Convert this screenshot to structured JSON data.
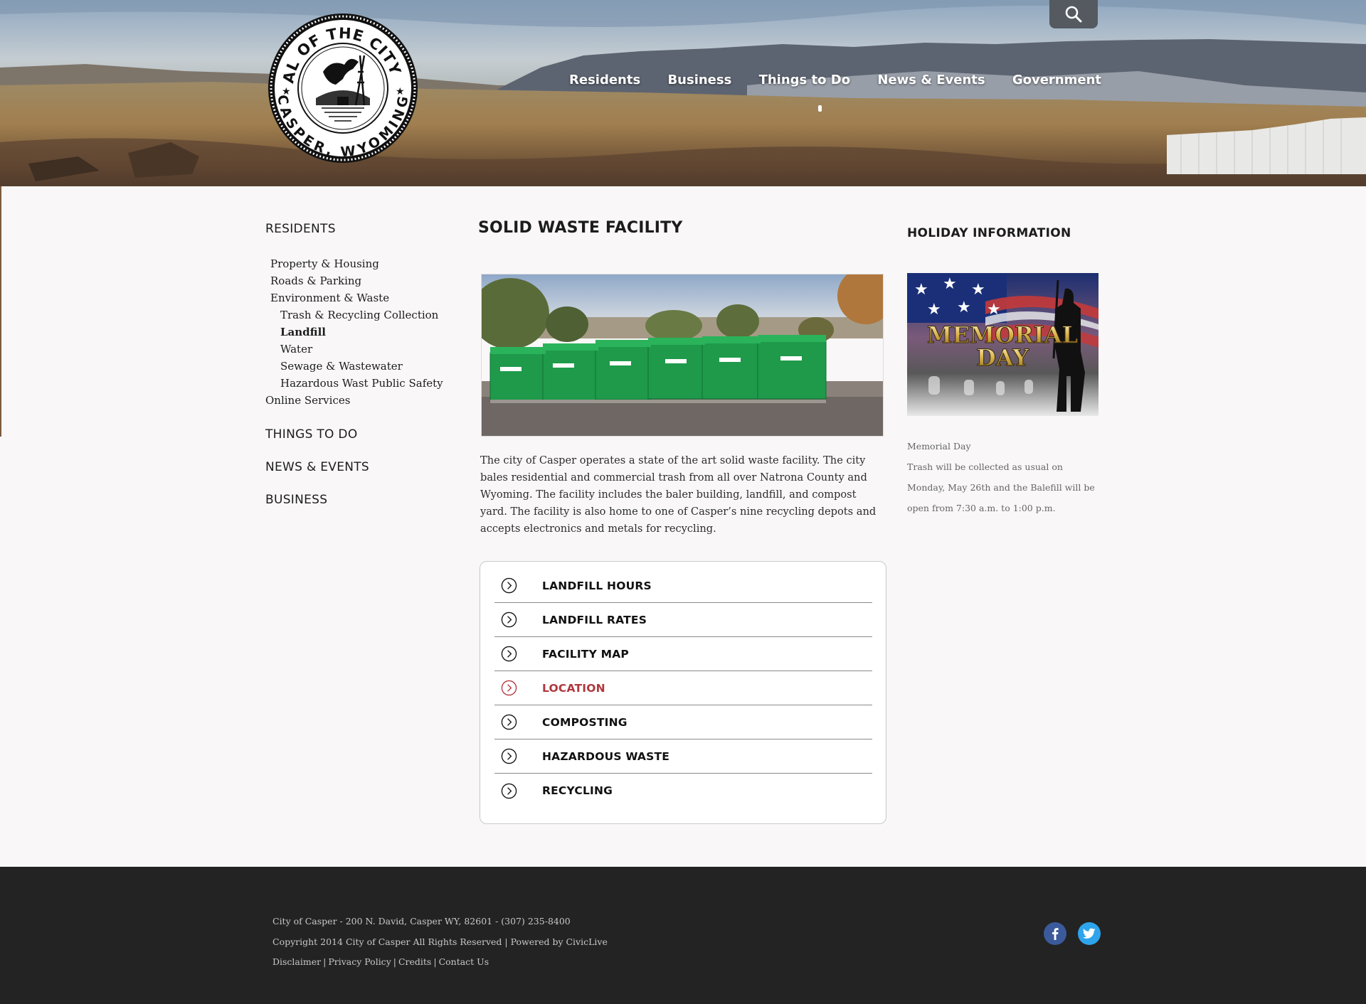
{
  "header": {
    "seal": {
      "top_text": "SEAL OF THE CITY OF",
      "bottom_text": "CASPER, WYOMING"
    },
    "nav": [
      {
        "label": "Residents"
      },
      {
        "label": "Business"
      },
      {
        "label": "Things to Do"
      },
      {
        "label": "News & Events"
      },
      {
        "label": "Government"
      }
    ],
    "search_icon": "search-icon"
  },
  "sidebar": {
    "heading": "RESIDENTS",
    "items": [
      {
        "label": "Property & Housing"
      },
      {
        "label": "Roads & Parking"
      },
      {
        "label": "Environment & Waste"
      },
      {
        "label": "Trash & Recycling Collection"
      },
      {
        "label": "Landfill"
      },
      {
        "label": "Water"
      },
      {
        "label": "Sewage & Wastewater"
      },
      {
        "label": "Hazardous Wast  Public Safety"
      },
      {
        "label": "Online Services"
      }
    ],
    "sections": [
      {
        "label": "THINGS TO DO"
      },
      {
        "label": "NEWS & EVENTS"
      },
      {
        "label": "BUSINESS"
      }
    ]
  },
  "main": {
    "title": "SOLID WASTE FACILITY",
    "intro": "The city of Casper operates a state of the art solid waste facility. The city bales residential and commercial trash from all over Natrona County and Wyoming. The facility includes the baler building, landfill, and compost yard. The facility is also home to one of Casper’s nine recycling depots and accepts electronics and metals for recycling.",
    "links": [
      {
        "label": "LANDFILL HOURS",
        "active": false
      },
      {
        "label": "LANDFILL RATES",
        "active": false
      },
      {
        "label": "FACILITY MAP",
        "active": false
      },
      {
        "label": "LOCATION",
        "active": true
      },
      {
        "label": "COMPOSTING",
        "active": false
      },
      {
        "label": "HAZARDOUS WASTE",
        "active": false
      },
      {
        "label": "RECYCLING",
        "active": false
      }
    ]
  },
  "holiday": {
    "heading": "HOLIDAY INFORMATION",
    "image_text": [
      "MEMORIAL",
      "DAY"
    ],
    "caption_title": "Memorial Day",
    "caption_body": "Trash will be collected as usual on Monday, May 26th and the Balefill will be open from 7:30 a.m. to 1:00 p.m."
  },
  "footer": {
    "address": "City of Casper - 200 N. David, Casper WY, 82601 - (307) 235-8400",
    "copyright": "Copyright 2014 City of Casper All Rights Reserved | Powered by CivicLive",
    "links": [
      {
        "label": "Disclaimer"
      },
      {
        "label": "Privacy Policy"
      },
      {
        "label": "Credits"
      },
      {
        "label": "Contact Us"
      }
    ],
    "social": [
      {
        "icon": "facebook-icon"
      },
      {
        "icon": "twitter-icon"
      }
    ]
  },
  "colors": {
    "active_link": "#b0373d",
    "footer_bg": "#232323",
    "facebook": "#3b5a9b",
    "twitter": "#2ea4ec"
  }
}
